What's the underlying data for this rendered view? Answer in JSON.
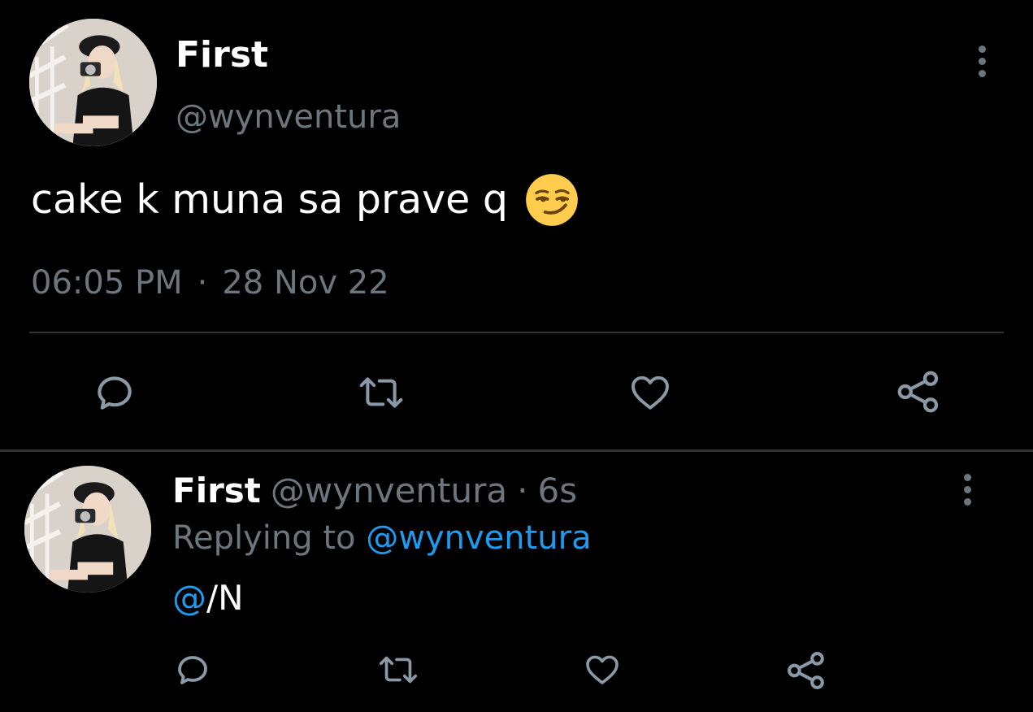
{
  "colors": {
    "background": "#000000",
    "primary_text": "#ffffff",
    "secondary_text": "#6e767d",
    "accent": "#1d9bf0",
    "divider": "#2f3336",
    "icon": "#8b98a5",
    "emoji_face": "#ffcc4d"
  },
  "main_tweet": {
    "author": {
      "display_name": "First",
      "handle": "@wynventura",
      "avatar_icon": "profile-photo"
    },
    "text": "cake k muna sa prave q",
    "emoji": "smirking-face",
    "time": "06:05 PM",
    "separator": "·",
    "date": "28 Nov 22",
    "more_icon": "vertical-ellipsis-icon",
    "actions": [
      {
        "name": "reply",
        "icon": "comment-icon"
      },
      {
        "name": "retweet",
        "icon": "retweet-icon"
      },
      {
        "name": "like",
        "icon": "heart-icon"
      },
      {
        "name": "share",
        "icon": "share-icon"
      }
    ]
  },
  "reply_tweet": {
    "author": {
      "display_name": "First",
      "handle": "@wynventura",
      "avatar_icon": "profile-photo"
    },
    "separator": "·",
    "relative_time": "6s",
    "replying_prefix": "Replying to",
    "replying_to": "@wynventura",
    "text_mention": "@",
    "text_rest": "/N",
    "more_icon": "vertical-ellipsis-icon",
    "actions": [
      {
        "name": "reply",
        "icon": "comment-icon"
      },
      {
        "name": "retweet",
        "icon": "retweet-icon"
      },
      {
        "name": "like",
        "icon": "heart-icon"
      },
      {
        "name": "share",
        "icon": "share-icon"
      }
    ]
  }
}
